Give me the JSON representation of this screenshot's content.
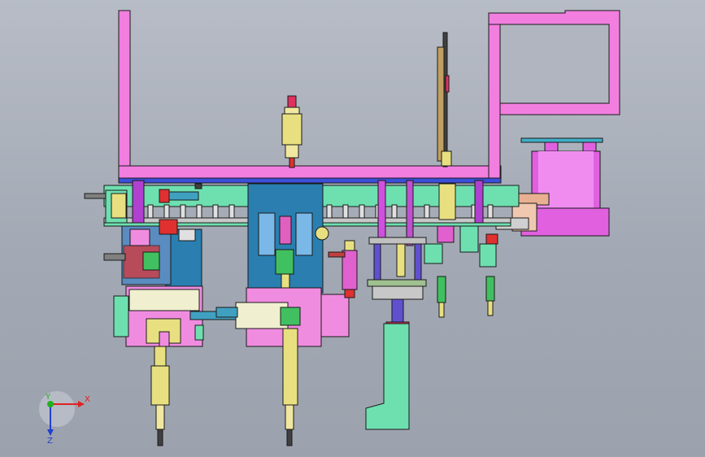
{
  "viewport": {
    "background_top": "#b7bcc6",
    "background_bottom": "#9ca2ad"
  },
  "model": {
    "palette": {
      "frame_magenta": "#f27ee0",
      "plate_blue": "#2a7fb0",
      "rail_green": "#6ee0b0",
      "part_yellow": "#e8e080",
      "part_pink": "#f08ce0",
      "part_red": "#e0303a",
      "outline": "#1a1a1a"
    }
  },
  "triad": {
    "x_axis_label": "X",
    "y_axis_label": "Y",
    "z_axis_label": "Z",
    "x_color": "#e02020",
    "y_color": "#20b020",
    "z_color": "#2040d0"
  }
}
